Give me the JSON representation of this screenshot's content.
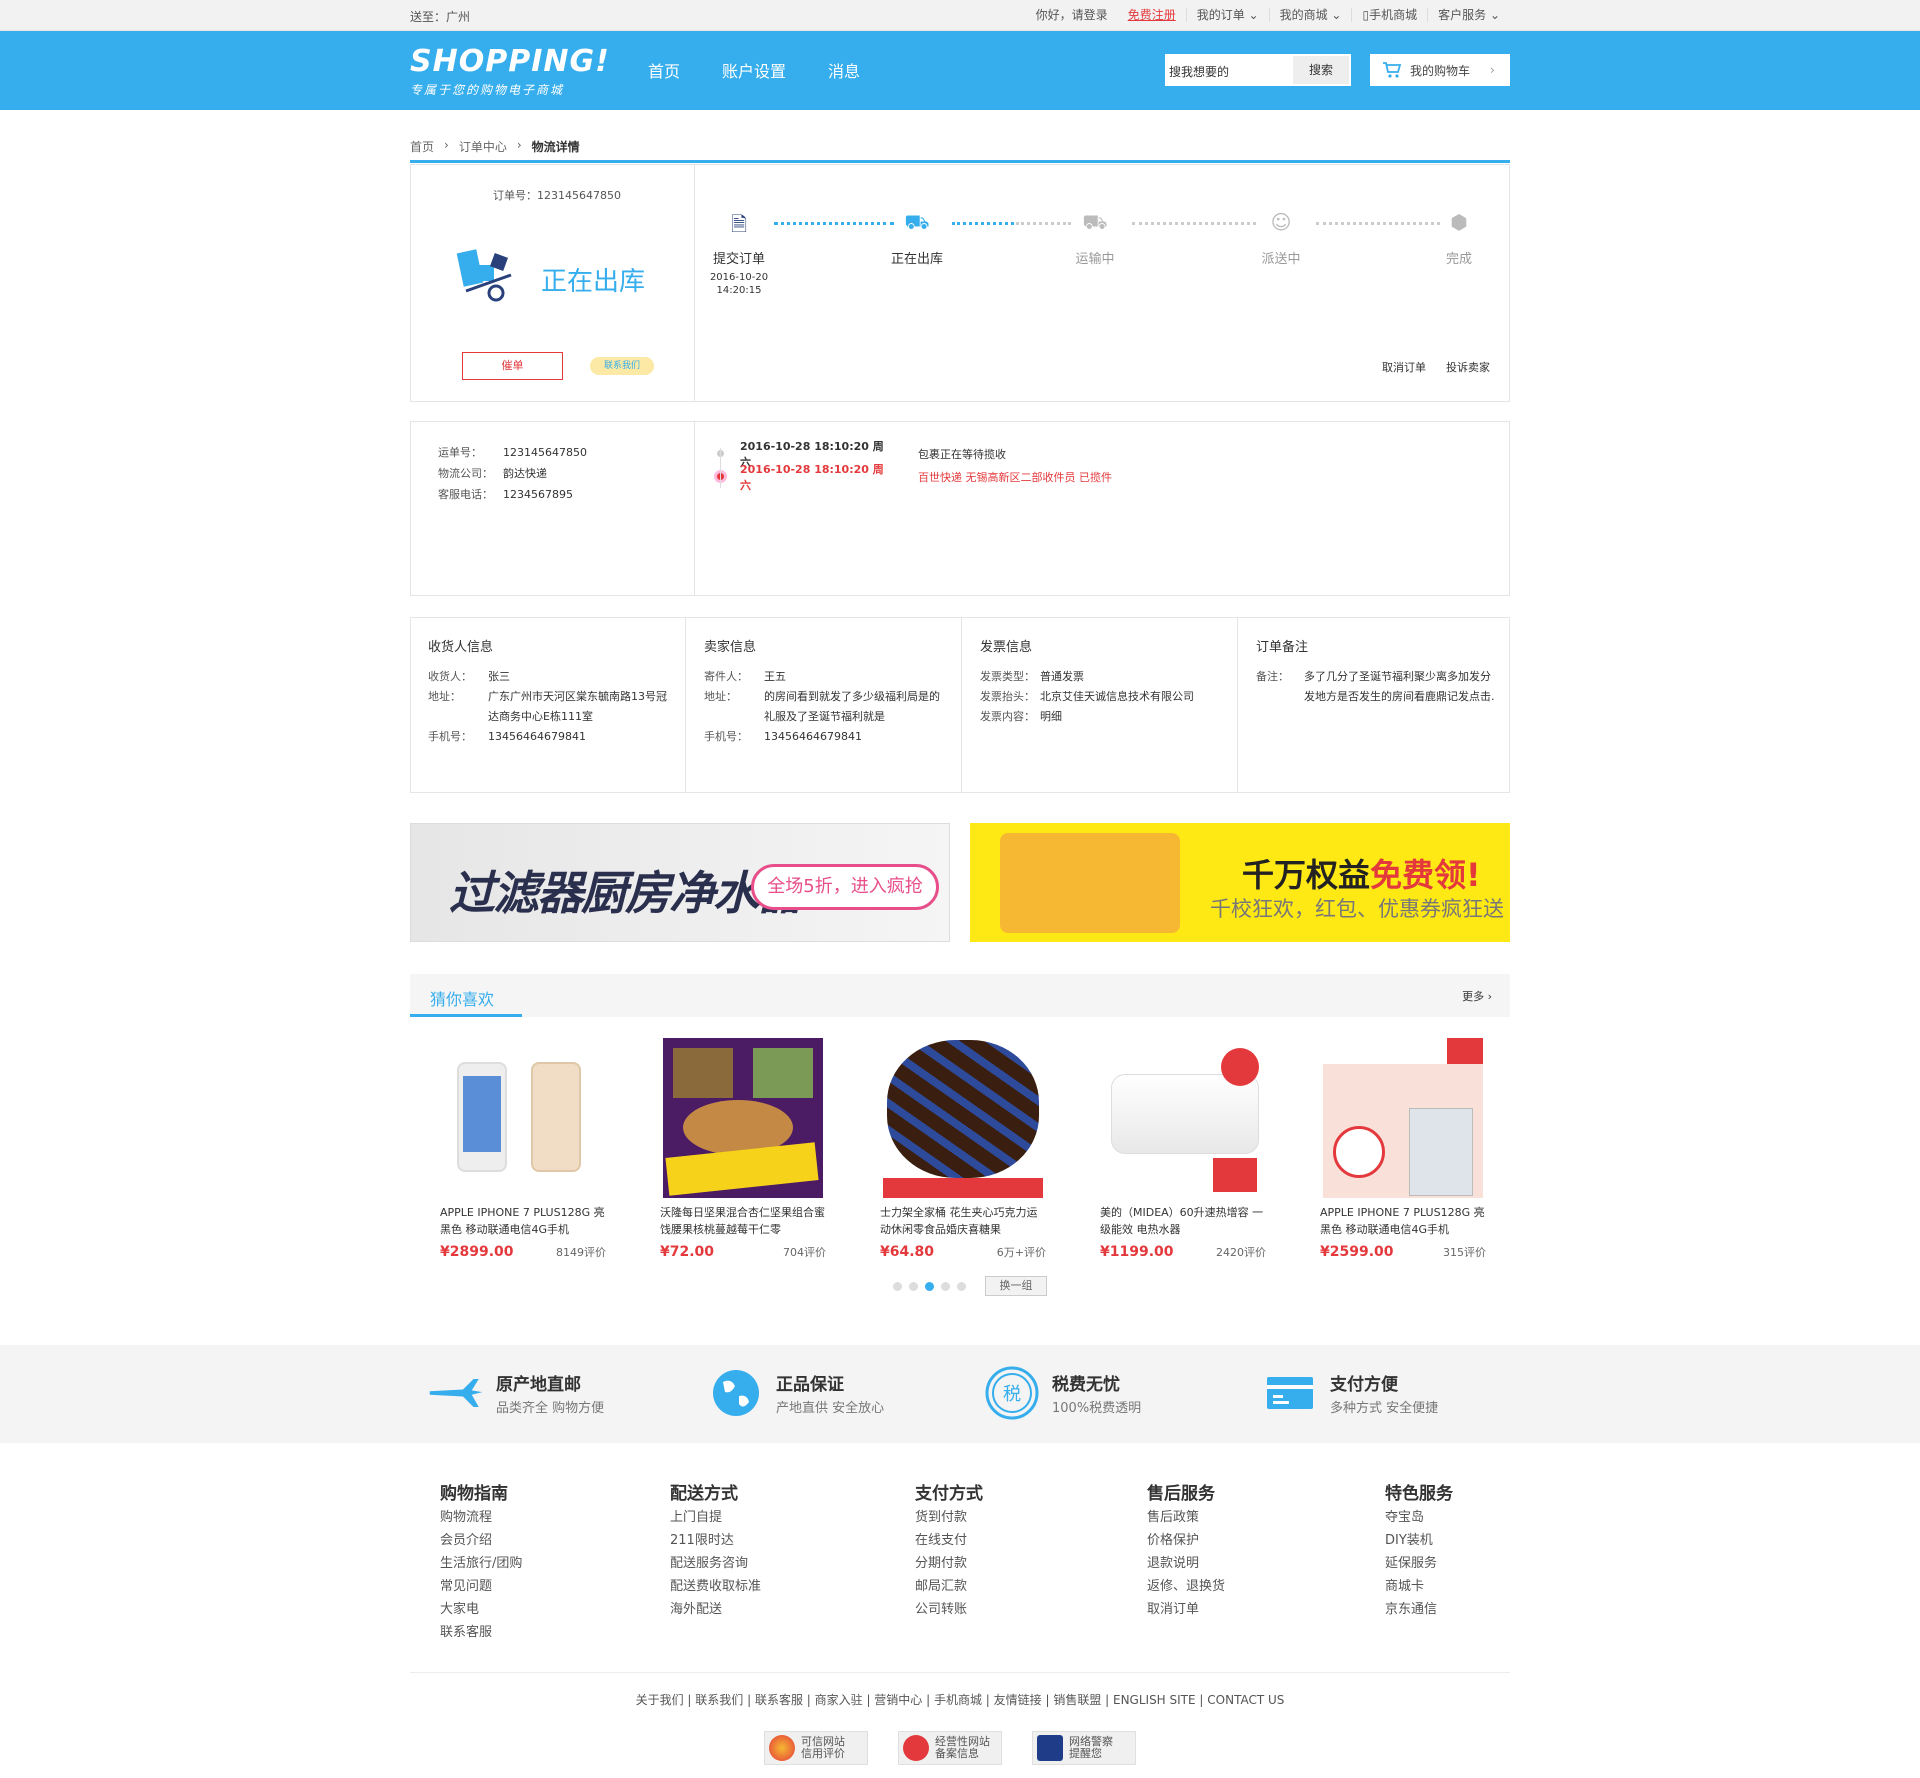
{
  "topbar": {
    "location": "送至：广州",
    "greeting": "你好，请登录",
    "register": "免费注册",
    "my_orders": "我的订单",
    "my_mall": "我的商城",
    "mobile": "手机商城",
    "service": "客户服务"
  },
  "header": {
    "logo": "SHOPPING!",
    "slogan": "专属于您的购物电子商城",
    "nav": [
      "首页",
      "账户设置",
      "消息"
    ],
    "search_placeholder": "搜我想要的",
    "search_btn": "搜索",
    "cart": "我的购物车"
  },
  "breadcrumb": [
    "首页",
    "订单中心",
    "物流详情"
  ],
  "status": {
    "order_no": "订单号：123145647850",
    "current": "正在出库",
    "urge": "催单",
    "contact": "联系我们",
    "steps": [
      {
        "label": "提交订单",
        "time": "2016-10-20",
        "time2": "14:20:15"
      },
      {
        "label": "正在出库"
      },
      {
        "label": "运输中"
      },
      {
        "label": "派送中"
      },
      {
        "label": "完成"
      }
    ],
    "cancel": "取消订单",
    "complain": "投诉卖家"
  },
  "logistics": {
    "waybill_k": "运单号：",
    "waybill": "123145647850",
    "company_k": "物流公司：",
    "company": "韵达快递",
    "phone_k": "客服电话：",
    "phone": "1234567895",
    "track": [
      {
        "date": "2016-10-28  18:10:20  周六",
        "msg": "包裹正在等待揽收"
      },
      {
        "date": "2016-10-28  18:10:20  周六",
        "msg": "百世快递  无锡高新区二部收件员  已揽件"
      }
    ]
  },
  "info": {
    "receiver": {
      "title": "收货人信息",
      "name_k": "收货人：",
      "name": "张三",
      "addr_k": "地址：",
      "addr": "广东广州市天河区棠东毓南路13号冠达商务中心E栋111室",
      "tel_k": "手机号：",
      "tel": "13456464679841"
    },
    "seller": {
      "title": "卖家信息",
      "name_k": "寄件人：",
      "name": "王五",
      "addr_k": "地址：",
      "addr": "的房间看到就发了多少级福利局是的礼服及了圣诞节福利就是",
      "tel_k": "手机号：",
      "tel": "13456464679841"
    },
    "invoice": {
      "title": "发票信息",
      "type_k": "发票类型：",
      "type": "普通发票",
      "head_k": "发票抬头：",
      "head": "北京艾佳天诚信息技术有限公司",
      "content_k": "发票内容：",
      "content": "明细"
    },
    "remark": {
      "title": "订单备注",
      "k": "备注：",
      "v": "多了几分了圣诞节福利聚少离多加发分发地方是否发生的房间看鹿鼎记发点击."
    }
  },
  "banners": {
    "b1": "过滤器厨房净水器",
    "b1_promo": "全场5折，进入疯抢",
    "b2_a": "千万权益",
    "b2_b": "免费领!",
    "b2_sub": "千校狂欢，红包、优惠券疯狂送"
  },
  "guess": {
    "title": "猜你喜欢",
    "more": "更多",
    "switch": "换一组",
    "items": [
      {
        "name": "APPLE IPHONE 7 PLUS128G 亮黑色 移动联通电信4G手机",
        "price": "¥2899.00",
        "reviews": "8149评价"
      },
      {
        "name": "沃隆每日坚果混合杏仁坚果组合蜜饯腰果核桃蔓越莓干仁零",
        "price": "¥72.00",
        "reviews": "704评价"
      },
      {
        "name": "士力架全家桶 花生夹心巧克力运动休闲零食品婚庆喜糖果",
        "price": "¥64.80",
        "reviews": "6万+评价"
      },
      {
        "name": "美的（MIDEA）60升速热增容 一级能效 电热水器",
        "price": "¥1199.00",
        "reviews": "2420评价"
      },
      {
        "name": "APPLE IPHONE 7 PLUS128G 亮黑色 移动联通电信4G手机",
        "price": "¥2599.00",
        "reviews": "315评价"
      }
    ]
  },
  "services": [
    {
      "t": "原产地直邮",
      "s": "品类齐全 购物方便"
    },
    {
      "t": "正品保证",
      "s": "产地直供 安全放心"
    },
    {
      "t": "税费无忧",
      "s": "100%税费透明"
    },
    {
      "t": "支付方便",
      "s": "多种方式 安全便捷"
    }
  ],
  "footer": {
    "cols": [
      {
        "t": "购物指南",
        "items": [
          "购物流程",
          "会员介绍",
          "生活旅行/团购",
          "常见问题",
          "大家电",
          "联系客服"
        ]
      },
      {
        "t": "配送方式",
        "items": [
          "上门自提",
          "211限时达",
          "配送服务咨询",
          "配送费收取标准",
          "海外配送"
        ]
      },
      {
        "t": "支付方式",
        "items": [
          "货到付款",
          "在线支付",
          "分期付款",
          "邮局汇款",
          "公司转账"
        ]
      },
      {
        "t": "售后服务",
        "items": [
          "售后政策",
          "价格保护",
          "退款说明",
          "返修、退换货",
          "取消订单"
        ]
      },
      {
        "t": "特色服务",
        "items": [
          "夺宝岛",
          "DIY装机",
          "延保服务",
          "商城卡",
          "京东通信"
        ]
      }
    ],
    "links": "关于我们 | 联系我们 | 联系客服 | 商家入驻 | 营销中心 | 手机商城 | 友情链接 | 销售联盟 | ENGLISH SITE | CONTACT US",
    "badges": [
      {
        "a": "可信网站",
        "b": "信用评价"
      },
      {
        "a": "经营性网站",
        "b": "备案信息"
      },
      {
        "a": "网络警察",
        "b": "提醒您"
      }
    ]
  }
}
